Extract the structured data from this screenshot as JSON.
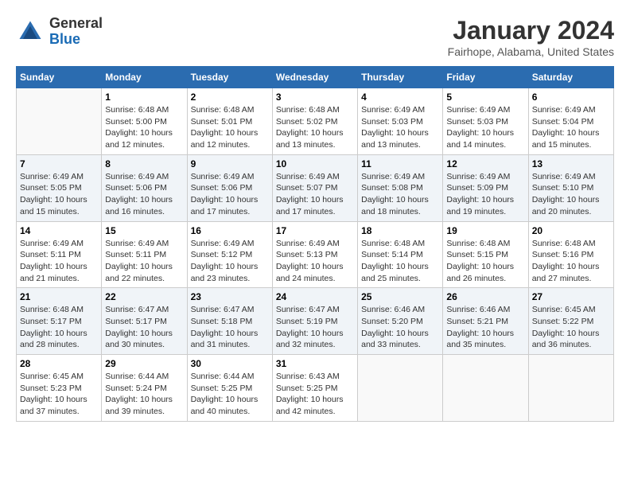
{
  "logo": {
    "general": "General",
    "blue": "Blue"
  },
  "title": {
    "month": "January 2024",
    "location": "Fairhope, Alabama, United States"
  },
  "weekdays": [
    "Sunday",
    "Monday",
    "Tuesday",
    "Wednesday",
    "Thursday",
    "Friday",
    "Saturday"
  ],
  "weeks": [
    [
      {
        "day": "",
        "sunrise": "",
        "sunset": "",
        "daylight": ""
      },
      {
        "day": "1",
        "sunrise": "Sunrise: 6:48 AM",
        "sunset": "Sunset: 5:00 PM",
        "daylight": "Daylight: 10 hours and 12 minutes."
      },
      {
        "day": "2",
        "sunrise": "Sunrise: 6:48 AM",
        "sunset": "Sunset: 5:01 PM",
        "daylight": "Daylight: 10 hours and 12 minutes."
      },
      {
        "day": "3",
        "sunrise": "Sunrise: 6:48 AM",
        "sunset": "Sunset: 5:02 PM",
        "daylight": "Daylight: 10 hours and 13 minutes."
      },
      {
        "day": "4",
        "sunrise": "Sunrise: 6:49 AM",
        "sunset": "Sunset: 5:03 PM",
        "daylight": "Daylight: 10 hours and 13 minutes."
      },
      {
        "day": "5",
        "sunrise": "Sunrise: 6:49 AM",
        "sunset": "Sunset: 5:03 PM",
        "daylight": "Daylight: 10 hours and 14 minutes."
      },
      {
        "day": "6",
        "sunrise": "Sunrise: 6:49 AM",
        "sunset": "Sunset: 5:04 PM",
        "daylight": "Daylight: 10 hours and 15 minutes."
      }
    ],
    [
      {
        "day": "7",
        "sunrise": "Sunrise: 6:49 AM",
        "sunset": "Sunset: 5:05 PM",
        "daylight": "Daylight: 10 hours and 15 minutes."
      },
      {
        "day": "8",
        "sunrise": "Sunrise: 6:49 AM",
        "sunset": "Sunset: 5:06 PM",
        "daylight": "Daylight: 10 hours and 16 minutes."
      },
      {
        "day": "9",
        "sunrise": "Sunrise: 6:49 AM",
        "sunset": "Sunset: 5:06 PM",
        "daylight": "Daylight: 10 hours and 17 minutes."
      },
      {
        "day": "10",
        "sunrise": "Sunrise: 6:49 AM",
        "sunset": "Sunset: 5:07 PM",
        "daylight": "Daylight: 10 hours and 17 minutes."
      },
      {
        "day": "11",
        "sunrise": "Sunrise: 6:49 AM",
        "sunset": "Sunset: 5:08 PM",
        "daylight": "Daylight: 10 hours and 18 minutes."
      },
      {
        "day": "12",
        "sunrise": "Sunrise: 6:49 AM",
        "sunset": "Sunset: 5:09 PM",
        "daylight": "Daylight: 10 hours and 19 minutes."
      },
      {
        "day": "13",
        "sunrise": "Sunrise: 6:49 AM",
        "sunset": "Sunset: 5:10 PM",
        "daylight": "Daylight: 10 hours and 20 minutes."
      }
    ],
    [
      {
        "day": "14",
        "sunrise": "Sunrise: 6:49 AM",
        "sunset": "Sunset: 5:11 PM",
        "daylight": "Daylight: 10 hours and 21 minutes."
      },
      {
        "day": "15",
        "sunrise": "Sunrise: 6:49 AM",
        "sunset": "Sunset: 5:11 PM",
        "daylight": "Daylight: 10 hours and 22 minutes."
      },
      {
        "day": "16",
        "sunrise": "Sunrise: 6:49 AM",
        "sunset": "Sunset: 5:12 PM",
        "daylight": "Daylight: 10 hours and 23 minutes."
      },
      {
        "day": "17",
        "sunrise": "Sunrise: 6:49 AM",
        "sunset": "Sunset: 5:13 PM",
        "daylight": "Daylight: 10 hours and 24 minutes."
      },
      {
        "day": "18",
        "sunrise": "Sunrise: 6:48 AM",
        "sunset": "Sunset: 5:14 PM",
        "daylight": "Daylight: 10 hours and 25 minutes."
      },
      {
        "day": "19",
        "sunrise": "Sunrise: 6:48 AM",
        "sunset": "Sunset: 5:15 PM",
        "daylight": "Daylight: 10 hours and 26 minutes."
      },
      {
        "day": "20",
        "sunrise": "Sunrise: 6:48 AM",
        "sunset": "Sunset: 5:16 PM",
        "daylight": "Daylight: 10 hours and 27 minutes."
      }
    ],
    [
      {
        "day": "21",
        "sunrise": "Sunrise: 6:48 AM",
        "sunset": "Sunset: 5:17 PM",
        "daylight": "Daylight: 10 hours and 28 minutes."
      },
      {
        "day": "22",
        "sunrise": "Sunrise: 6:47 AM",
        "sunset": "Sunset: 5:17 PM",
        "daylight": "Daylight: 10 hours and 30 minutes."
      },
      {
        "day": "23",
        "sunrise": "Sunrise: 6:47 AM",
        "sunset": "Sunset: 5:18 PM",
        "daylight": "Daylight: 10 hours and 31 minutes."
      },
      {
        "day": "24",
        "sunrise": "Sunrise: 6:47 AM",
        "sunset": "Sunset: 5:19 PM",
        "daylight": "Daylight: 10 hours and 32 minutes."
      },
      {
        "day": "25",
        "sunrise": "Sunrise: 6:46 AM",
        "sunset": "Sunset: 5:20 PM",
        "daylight": "Daylight: 10 hours and 33 minutes."
      },
      {
        "day": "26",
        "sunrise": "Sunrise: 6:46 AM",
        "sunset": "Sunset: 5:21 PM",
        "daylight": "Daylight: 10 hours and 35 minutes."
      },
      {
        "day": "27",
        "sunrise": "Sunrise: 6:45 AM",
        "sunset": "Sunset: 5:22 PM",
        "daylight": "Daylight: 10 hours and 36 minutes."
      }
    ],
    [
      {
        "day": "28",
        "sunrise": "Sunrise: 6:45 AM",
        "sunset": "Sunset: 5:23 PM",
        "daylight": "Daylight: 10 hours and 37 minutes."
      },
      {
        "day": "29",
        "sunrise": "Sunrise: 6:44 AM",
        "sunset": "Sunset: 5:24 PM",
        "daylight": "Daylight: 10 hours and 39 minutes."
      },
      {
        "day": "30",
        "sunrise": "Sunrise: 6:44 AM",
        "sunset": "Sunset: 5:25 PM",
        "daylight": "Daylight: 10 hours and 40 minutes."
      },
      {
        "day": "31",
        "sunrise": "Sunrise: 6:43 AM",
        "sunset": "Sunset: 5:25 PM",
        "daylight": "Daylight: 10 hours and 42 minutes."
      },
      {
        "day": "",
        "sunrise": "",
        "sunset": "",
        "daylight": ""
      },
      {
        "day": "",
        "sunrise": "",
        "sunset": "",
        "daylight": ""
      },
      {
        "day": "",
        "sunrise": "",
        "sunset": "",
        "daylight": ""
      }
    ]
  ]
}
